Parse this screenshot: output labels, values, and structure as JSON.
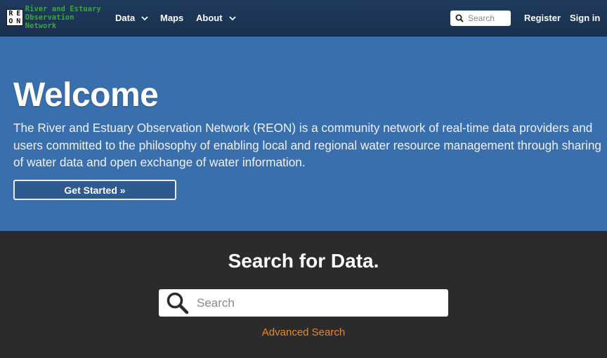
{
  "navbar": {
    "logo": {
      "letters": [
        "R",
        "E",
        "O",
        "N"
      ],
      "line1": "River and Estuary",
      "line2": "Observation Network",
      "color": "#3aa83a"
    },
    "menu": [
      {
        "label": "Data",
        "has_dropdown": true
      },
      {
        "label": "Maps",
        "has_dropdown": false
      },
      {
        "label": "About",
        "has_dropdown": true
      }
    ],
    "search": {
      "placeholder": "Search",
      "icon": "search-icon"
    },
    "register_label": "Register",
    "signin_label": "Sign in",
    "background": "#1d3557"
  },
  "hero": {
    "title": "Welcome",
    "description": "The River and Estuary Observation Network (REON) is a community network of real-time data providers and users committed to the philosophy of enabling local and regional water resource management through sharing of water data and open exchange of water information.",
    "cta_label": "Get Started »",
    "background": "#3a6fae"
  },
  "search_section": {
    "title": "Search for Data.",
    "search_placeholder": "Search",
    "search_icon": "search-icon",
    "advanced_label": "Advanced Search",
    "link_color": "#e8872a",
    "background": "#2b2b2b"
  }
}
